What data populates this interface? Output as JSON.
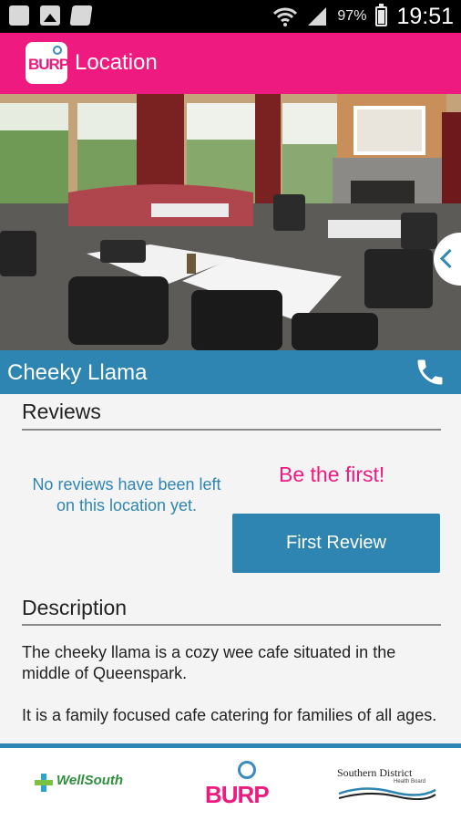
{
  "status_bar": {
    "battery_percent": "97%",
    "time": "19:51",
    "icons": [
      "clipboard-icon",
      "image-icon",
      "sd-card-icon",
      "wifi-icon",
      "signal-icon",
      "battery-icon"
    ]
  },
  "app_bar": {
    "logo_text": "BURP",
    "title": "Location"
  },
  "location": {
    "name": "Cheeky Llama"
  },
  "reviews": {
    "heading": "Reviews",
    "empty_message": "No reviews have been left on this location yet.",
    "be_first": "Be the first!",
    "first_review_button": "First Review"
  },
  "description": {
    "heading": "Description",
    "paragraphs": [
      "The cheeky llama is a cozy wee cafe situated in the middle of Queenspark.",
      "It is a family focused cafe catering for families of all ages."
    ]
  },
  "footer": {
    "wellsouth": "WellSouth",
    "burp": "BURP",
    "sdhb": "Southern District",
    "sdhb_sub": "Health Board"
  },
  "colors": {
    "primary_pink": "#ee1a80",
    "primary_blue": "#2e85b1"
  }
}
